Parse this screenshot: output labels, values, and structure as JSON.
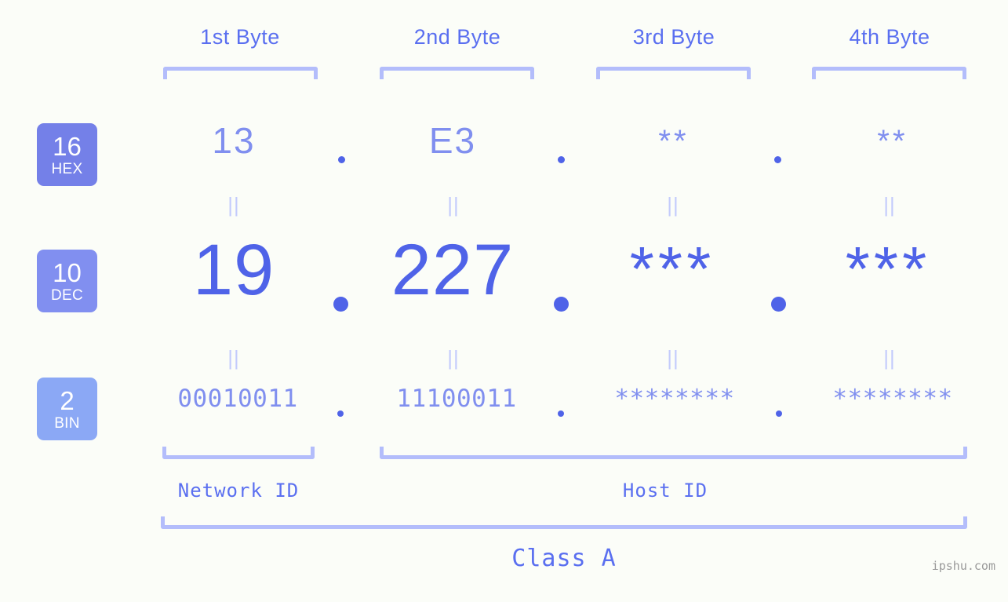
{
  "meta": {
    "background_color": "#fbfdf8",
    "accent_strong": "#4f63e8",
    "accent_mid": "#808fef",
    "accent_light": "#b3bdfb",
    "accent_faint": "#c3cbfc",
    "watermark_color": "#9a9a9a"
  },
  "byte_headers": [
    {
      "label": "1st Byte"
    },
    {
      "label": "2nd Byte"
    },
    {
      "label": "3rd Byte"
    },
    {
      "label": "4th Byte"
    }
  ],
  "radix_badges": [
    {
      "number": "16",
      "name": "HEX",
      "color": "#7480e8"
    },
    {
      "number": "10",
      "name": "DEC",
      "color": "#818ff0"
    },
    {
      "number": "2",
      "name": "BIN",
      "color": "#8ba8f5"
    }
  ],
  "rows": {
    "hex": {
      "radix": "16",
      "name": "HEX",
      "values": [
        "13",
        "E3",
        "**",
        "**"
      ],
      "separator": "."
    },
    "dec": {
      "radix": "10",
      "name": "DEC",
      "values": [
        "19",
        "227",
        "***",
        "***"
      ],
      "separator": "."
    },
    "bin": {
      "radix": "2",
      "name": "BIN",
      "values": [
        "00010011",
        "11100011",
        "********",
        "********"
      ],
      "separator": "."
    }
  },
  "equality_marks": [
    "||",
    "||",
    "||",
    "||",
    "||",
    "||",
    "||",
    "||"
  ],
  "segments": {
    "network_id": "Network ID",
    "host_id": "Host ID",
    "class": "Class A"
  },
  "watermark": "ipshu.com"
}
